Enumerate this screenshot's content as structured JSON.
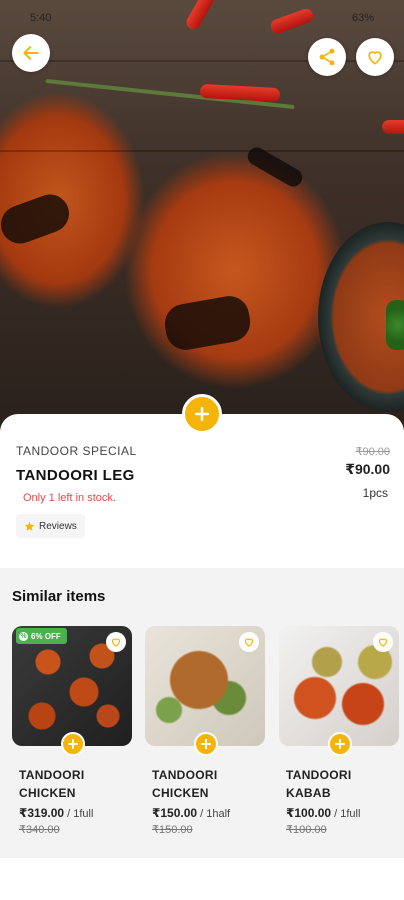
{
  "status_bar": {
    "time": "5:40",
    "battery": "63%"
  },
  "hero": {
    "image_desc": "tandoori-chicken-photo"
  },
  "product": {
    "category": "TANDOOR SPECIAL",
    "name": "TANDOORI LEG",
    "stock_note": "Only 1 left in stock.",
    "reviews_label": "Reviews",
    "old_price": "₹90.00",
    "price": "₹90.00",
    "unit": "1pcs"
  },
  "similar": {
    "title": "Similar items",
    "items": [
      {
        "name": "TANDOORI CHICKEN",
        "price": "₹319.00",
        "unit": " / 1full",
        "old_price": "₹340.00",
        "badge": "6% OFF"
      },
      {
        "name": "TANDOORI CHICKEN",
        "price": "₹150.00",
        "unit": " / 1half",
        "old_price": "₹150.00",
        "badge": ""
      },
      {
        "name": "TANDOORI KABAB",
        "price": "₹100.00",
        "unit": " / 1full",
        "old_price": "₹100.00",
        "badge": ""
      }
    ]
  },
  "colors": {
    "accent": "#f5b40a",
    "stock_red": "#e04a4a",
    "discount_green": "#4caf50"
  }
}
